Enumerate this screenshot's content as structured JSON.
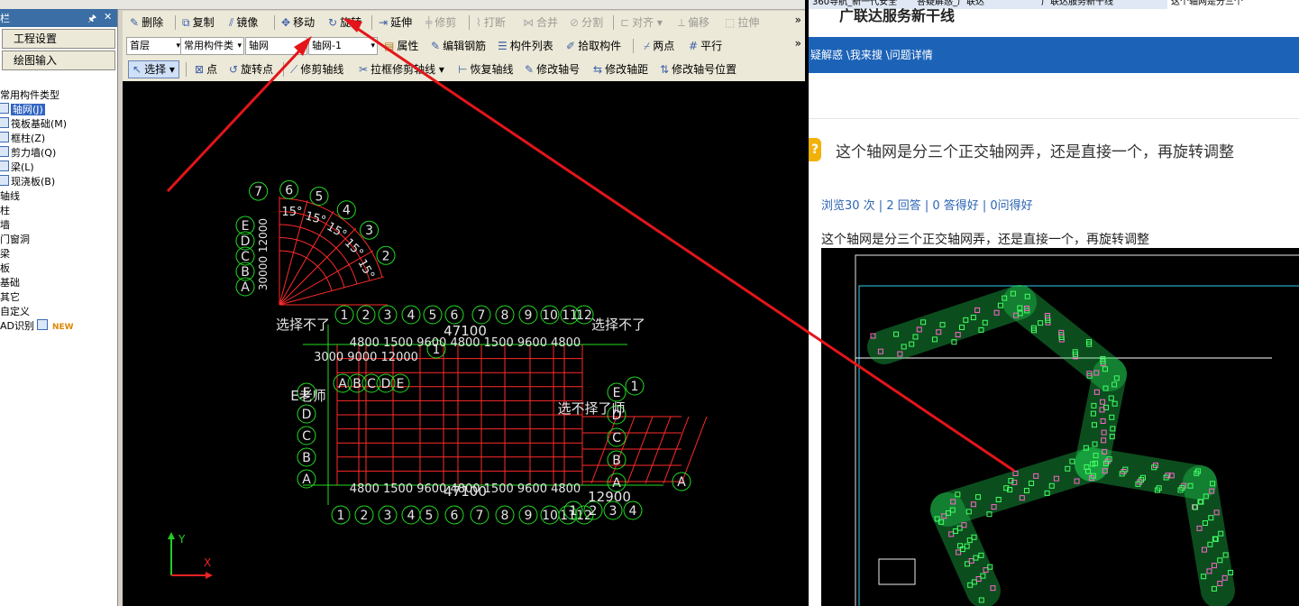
{
  "cad": {
    "sidebar": {
      "head_left": "栏",
      "head_pin": "🖈",
      "head_close": "✕",
      "buttons": [
        "工程设置",
        "绘图输入"
      ],
      "tree": [
        {
          "label": "常用构件类型",
          "indent": 0,
          "icon": false
        },
        {
          "label": "轴网(J)",
          "indent": 1,
          "icon": true,
          "selected": true
        },
        {
          "label": "筏板基础(M)",
          "indent": 1,
          "icon": true
        },
        {
          "label": "框柱(Z)",
          "indent": 1,
          "icon": true
        },
        {
          "label": "剪力墙(Q)",
          "indent": 1,
          "icon": true
        },
        {
          "label": "梁(L)",
          "indent": 1,
          "icon": true
        },
        {
          "label": "现浇板(B)",
          "indent": 1,
          "icon": true
        },
        {
          "label": "轴线",
          "indent": 0,
          "icon": false
        },
        {
          "label": "柱",
          "indent": 0,
          "icon": false
        },
        {
          "label": "墙",
          "indent": 0,
          "icon": false
        },
        {
          "label": "门窗洞",
          "indent": 0,
          "icon": false
        },
        {
          "label": "梁",
          "indent": 0,
          "icon": false
        },
        {
          "label": "板",
          "indent": 0,
          "icon": false
        },
        {
          "label": "基础",
          "indent": 0,
          "icon": false
        },
        {
          "label": "其它",
          "indent": 0,
          "icon": false
        },
        {
          "label": "自定义",
          "indent": 0,
          "icon": false
        },
        {
          "label": "AD识别",
          "indent": 0,
          "icon": false,
          "badge": "NEW"
        }
      ]
    },
    "toolbar1": {
      "delete": "删除",
      "copy": "复制",
      "mirror": "镜像",
      "move": "移动",
      "rotate": "旋转",
      "extend": "延伸",
      "trim": "修剪",
      "break": "打断",
      "merge": "合并",
      "split": "分割",
      "align": "对齐",
      "offset": "偏移",
      "stretch": "拉伸",
      "more": "»"
    },
    "toolbar2": {
      "floor": "首层",
      "category": "常用构件类",
      "type": "轴网",
      "name": "轴网-1",
      "props": "属性",
      "rebar": "编辑钢筋",
      "list": "构件列表",
      "pick": "拾取构件",
      "twopoint": "两点",
      "parallel": "平行",
      "more": "»"
    },
    "toolbar3": {
      "select": "选择",
      "point": "点",
      "rotate_point": "旋转点",
      "trim_axis": "修剪轴线",
      "box_trim_axis": "拉框修剪轴线",
      "restore_axis": "恢复轴线",
      "edit_axis_no": "修改轴号",
      "edit_axis_dist": "修改轴距",
      "edit_axis_no_pos": "修改轴号位置"
    },
    "canvas": {
      "axis_x": "X",
      "axis_y": "Y",
      "fan_numbers": [
        "7",
        "6",
        "5",
        "4",
        "3",
        "2"
      ],
      "fan_angles": [
        "15°",
        "15°",
        "15°",
        "15°",
        "15°"
      ],
      "fan_letters": [
        "E",
        "D",
        "C",
        "B",
        "A"
      ],
      "fan_dim_text": "30000 12000",
      "note_left": "选择不了",
      "note_right": "选择不了",
      "note_middle": "选不择了师",
      "note_teacher": "E老师",
      "top_numbers": [
        "1",
        "2",
        "3",
        "4",
        "5",
        "6",
        "7",
        "8",
        "9",
        "10",
        "11",
        "12"
      ],
      "bottom_numbers": [
        "1",
        "2",
        "3",
        "4",
        "5",
        "6",
        "7",
        "8",
        "9",
        "10",
        "11",
        "12"
      ],
      "top_dim_total": "47100",
      "top_dim_row": "4800 1500 9600 4800 1500 9600 4800",
      "top_dim_row2": "3000 9000 12000",
      "bottom_dim_total": "47100",
      "bottom_dim_row": "4800 1500 9600 4800 1500 9600 4800",
      "bottom_dim_right": "12900",
      "left_letters": [
        "E",
        "D",
        "C",
        "B",
        "A"
      ],
      "mid_letters": [
        "A",
        "B",
        "C",
        "D",
        "E"
      ],
      "right_letters": [
        "E",
        "D",
        "C",
        "B",
        "A"
      ],
      "right_numbers_small": [
        "1",
        "2",
        "3",
        "4"
      ],
      "right_extra": [
        "1",
        "A"
      ]
    }
  },
  "browser": {
    "tabs": [
      "360导航_新一代安全",
      "答疑解惑_广联达",
      "广联达服务新干线",
      "这个轴网是分三个"
    ],
    "slogan": "广联达服务新干线",
    "nav": "疑解惑 \\我来搜 \\问题详情",
    "question_title": "这个轴网是分三个正交轴网弄，还是直接一个，再旋转调整",
    "stats": "浏览30 次 | 2 回答 | 0 答得好 | 0问得好",
    "body": "这个轴网是分三个正交轴网弄，还是直接一个，再旋转调整",
    "icon_q": "?"
  },
  "colors": {
    "grid_red": "#ff2a2a",
    "axis_green": "#22dd22",
    "text_white": "#e6e6e6",
    "arrow_red": "#e3151a",
    "nav_blue": "#1c63b8"
  }
}
